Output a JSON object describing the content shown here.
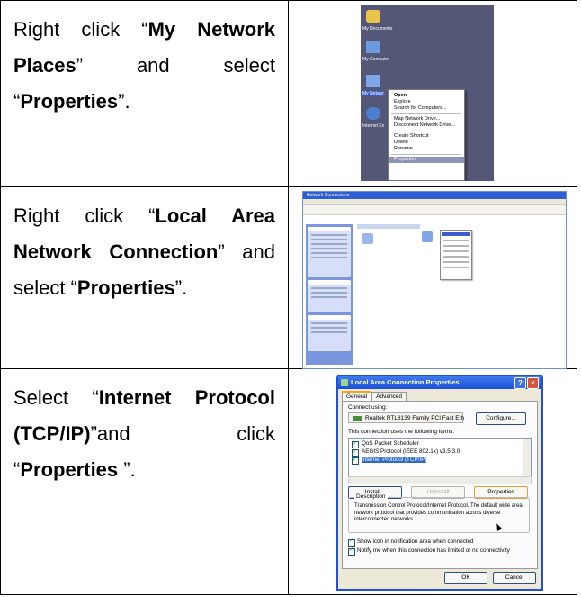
{
  "steps": [
    {
      "pre1": "Right click “",
      "bold1": "My Network Places",
      "mid": "” and select “",
      "bold2": "Properties",
      "post": "”."
    },
    {
      "pre1": "Right click “",
      "bold1": "Local Area Network Connection",
      "mid": "” and select “",
      "bold2": "Properties",
      "post": "”."
    },
    {
      "pre1": "Select “",
      "bold1": "Internet Protocol (TCP/IP)",
      "mid": "”and click “",
      "bold2": "Properties ",
      "post": "”."
    }
  ],
  "desktop": {
    "icons": [
      "My Documents",
      "My Computer",
      "My Network Places",
      "Internet Explorer"
    ],
    "menu": [
      "Open",
      "Explore",
      "Search for Computers...",
      "Map Network Drive...",
      "Disconnect Network Drive...",
      "Create Shortcut",
      "Delete",
      "Rename",
      "Properties"
    ]
  },
  "network_window": {
    "title": "Network Connections",
    "connection": "LAN or High-Speed Internet",
    "connection_name": "Local Area Connection"
  },
  "dialog": {
    "title": "Local Area Connection Properties",
    "tabs": [
      "General",
      "Advanced"
    ],
    "connect_using_label": "Connect using:",
    "device": "Realtek RTL8139 Family PCI Fast Eth",
    "configure": "Configure...",
    "items_label": "This connection uses the following items:",
    "items": [
      "QoS Packet Scheduler",
      "AEGIS Protocol (IEEE 802.1x) v3.5.3.0",
      "Internet Protocol (TCP/IP)"
    ],
    "install": "Install...",
    "uninstall": "Uninstall",
    "properties": "Properties",
    "description_label": "Description",
    "description": "Transmission Control Protocol/Internet Protocol. The default wide area network protocol that provides communication across diverse interconnected networks.",
    "show_icon": "Show icon in notification area when connected",
    "notify": "Notify me when this connection has limited or no connectivity",
    "ok": "OK",
    "cancel": "Cancel",
    "help_glyph": "?",
    "close_glyph": "×"
  }
}
